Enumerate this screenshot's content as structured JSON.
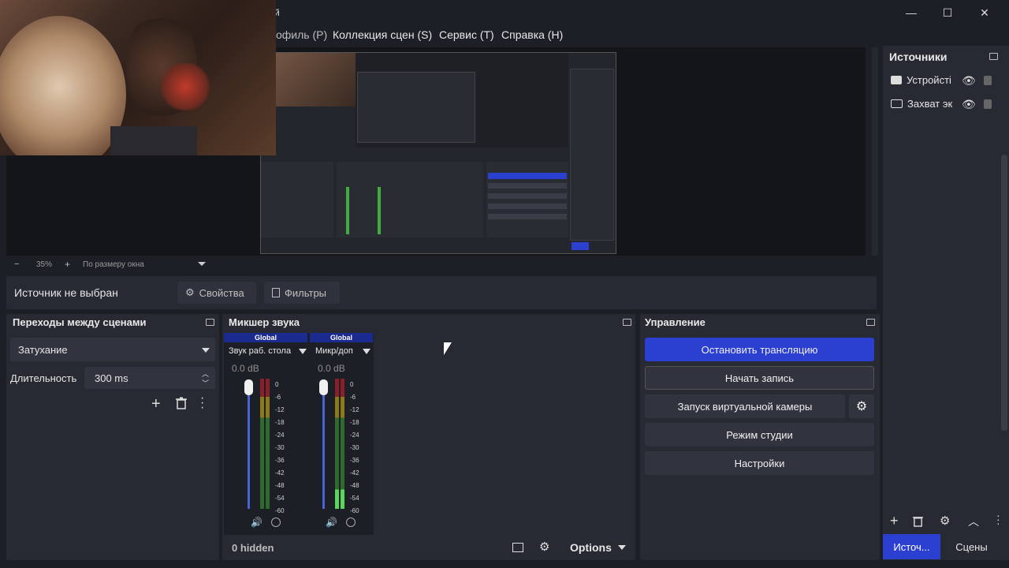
{
  "window": {
    "title": "й",
    "minimize": "—",
    "maximize": "☐",
    "close": "✕"
  },
  "menu": {
    "profile": "офиль (P)",
    "scene_collection": "Коллекция сцен (S)",
    "tools": "Сервис (T)",
    "help": "Справка (H)"
  },
  "preview": {
    "zoom_minus": "−",
    "zoom_value": "35%",
    "zoom_plus": "+",
    "fit_label": "По размеру окна"
  },
  "source_bar": {
    "no_source": "Источник не выбран",
    "properties": "Свойства",
    "filters": "Фильтры"
  },
  "transitions": {
    "title": "Переходы между сценами",
    "selected": "Затухание",
    "duration_label": "Длительность",
    "duration_value": "300 ms"
  },
  "mixer": {
    "title": "Микшер звука",
    "channels": [
      {
        "header": "Global",
        "name": "Звук раб. стола",
        "db": "0.0 dB",
        "level": 0.0
      },
      {
        "header": "Global",
        "name": "Микр/доп",
        "db": "0.0 dB",
        "level": 0.1
      }
    ],
    "scale": [
      "0",
      "-6",
      "-12",
      "-18",
      "-24",
      "-30",
      "-36",
      "-42",
      "-48",
      "-54",
      "-60"
    ],
    "hidden": "0 hidden",
    "options": "Options"
  },
  "controls": {
    "title": "Управление",
    "stop_stream": "Остановить трансляцию",
    "start_record": "Начать запись",
    "virtual_cam": "Запуск виртуальной камеры",
    "studio_mode": "Режим студии",
    "settings": "Настройки"
  },
  "sources": {
    "title": "Источники",
    "items": [
      {
        "label": "Устройсті",
        "icon": "camera-icon"
      },
      {
        "label": "Захват эк",
        "icon": "monitor-icon"
      }
    ],
    "tab_sources": "Источ...",
    "tab_scenes": "Сцены"
  },
  "colors": {
    "accent": "#2b3fd0",
    "background": "#1d1f26",
    "panel": "#272a33",
    "meter_green": "#3fae3f",
    "meter_yellow": "#a08a1a",
    "meter_red": "#8a1f2a"
  }
}
